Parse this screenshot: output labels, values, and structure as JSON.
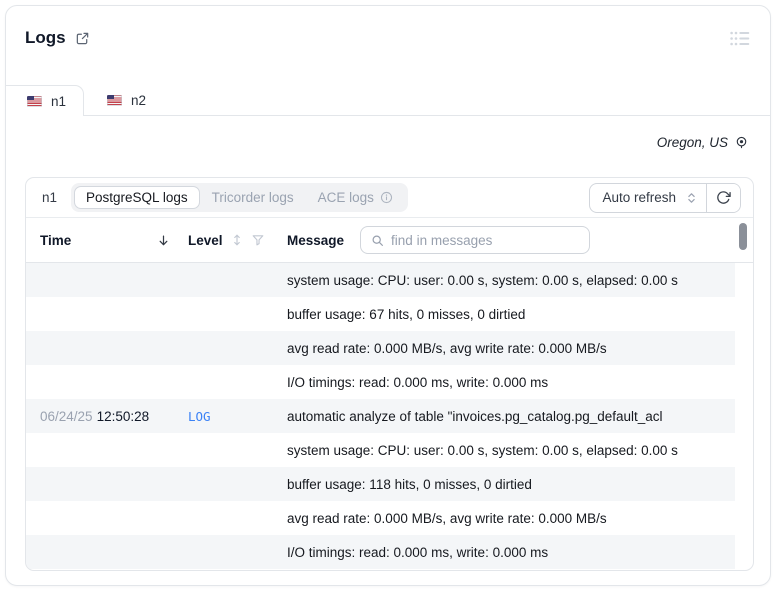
{
  "window": {
    "title": "Logs"
  },
  "tabs": [
    {
      "label": "n1"
    },
    {
      "label": "n2"
    }
  ],
  "region": {
    "label": "Oregon, US"
  },
  "toolbar": {
    "node": "n1",
    "sources": [
      {
        "label": "PostgreSQL logs"
      },
      {
        "label": "Tricorder logs"
      },
      {
        "label": "ACE logs"
      }
    ],
    "refresh": {
      "label": "Auto refresh"
    }
  },
  "table": {
    "columns": {
      "time": "Time",
      "level": "Level",
      "message": "Message"
    },
    "search_placeholder": "find in messages",
    "rows": [
      {
        "date": "",
        "time": "",
        "level": "",
        "message": "system usage: CPU: user: 0.00 s, system: 0.00 s, elapsed: 0.00 s"
      },
      {
        "date": "",
        "time": "",
        "level": "",
        "message": "buffer usage: 67 hits, 0 misses, 0 dirtied"
      },
      {
        "date": "",
        "time": "",
        "level": "",
        "message": "avg read rate: 0.000 MB/s, avg write rate: 0.000 MB/s"
      },
      {
        "date": "",
        "time": "",
        "level": "",
        "message": "I/O timings: read: 0.000 ms, write: 0.000 ms"
      },
      {
        "date": "06/24/25",
        "time": "12:50:28",
        "level": "LOG",
        "message": "automatic analyze of table \"invoices.pg_catalog.pg_default_acl"
      },
      {
        "date": "",
        "time": "",
        "level": "",
        "message": "system usage: CPU: user: 0.00 s, system: 0.00 s, elapsed: 0.00 s"
      },
      {
        "date": "",
        "time": "",
        "level": "",
        "message": "buffer usage: 118 hits, 0 misses, 0 dirtied"
      },
      {
        "date": "",
        "time": "",
        "level": "",
        "message": "avg read rate: 0.000 MB/s, avg write rate: 0.000 MB/s"
      },
      {
        "date": "",
        "time": "",
        "level": "",
        "message": "I/O timings: read: 0.000 ms, write: 0.000 ms"
      }
    ]
  },
  "icons": {
    "external-link": "open in new window",
    "list-menu": "widget options",
    "location-pin": "region marker",
    "info": "info circle",
    "updown-chevrons": "select expander",
    "refresh": "reload logs",
    "arrow-down": "sorted descending",
    "updown-arrows": "sortable",
    "funnel": "filter",
    "magnifier": "search"
  },
  "colors": {
    "accent_blue": "#3b82f6",
    "alt_row": "#f4f6f8",
    "border": "#e3e6ea",
    "muted_text": "#98a0ae"
  }
}
